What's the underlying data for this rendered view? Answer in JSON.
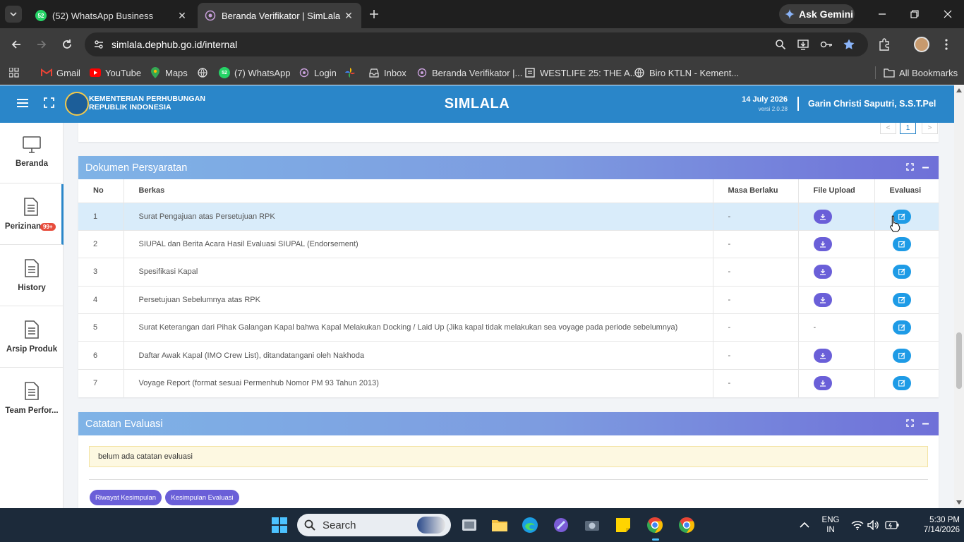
{
  "browser": {
    "tabs": [
      {
        "title": "(52) WhatsApp Business",
        "favicon": "whatsapp-icon",
        "active": false,
        "badge": "52"
      },
      {
        "title": "Beranda Verifikator | SimLala",
        "favicon": "simlala-icon",
        "active": true
      }
    ],
    "ask_gemini": "Ask Gemini",
    "url": "simlala.dephub.go.id/internal",
    "bookmarks": [
      {
        "label": "Gmail",
        "icon": "gmail-icon"
      },
      {
        "label": "YouTube",
        "icon": "youtube-icon"
      },
      {
        "label": "Maps",
        "icon": "maps-icon"
      },
      {
        "label": "",
        "icon": "globe-icon"
      },
      {
        "label": "(7) WhatsApp",
        "icon": "whatsapp-icon"
      },
      {
        "label": "Login",
        "icon": "simlala-icon"
      },
      {
        "label": "",
        "icon": "pinwheel-icon"
      },
      {
        "label": "Inbox",
        "icon": "inbox-icon"
      },
      {
        "label": "Beranda Verifikator |...",
        "icon": "simlala-icon"
      },
      {
        "label": "WESTLIFE 25: THE A...",
        "icon": "page-icon"
      },
      {
        "label": "Biro KTLN - Kement...",
        "icon": "globe-icon"
      }
    ],
    "all_bookmarks": "All Bookmarks"
  },
  "app": {
    "org_line1": "KEMENTERIAN PERHUBUNGAN",
    "org_line2": "REPUBLIK INDONESIA",
    "title": "SIMLALA",
    "date": "14 July 2026",
    "version": "versi 2.0.28",
    "user": "Garin Christi Saputri, S.S.T.Pel"
  },
  "sidebar": {
    "items": [
      {
        "label": "Beranda",
        "icon": "monitor-icon"
      },
      {
        "label": "Perizinan",
        "icon": "document-icon",
        "badge": "99+",
        "active": true
      },
      {
        "label": "History",
        "icon": "document-icon"
      },
      {
        "label": "Arsip Produk",
        "icon": "document-icon"
      },
      {
        "label": "Team Perfor...",
        "icon": "document-icon"
      }
    ]
  },
  "pagination": {
    "prev": "<",
    "current": "1",
    "next": ">"
  },
  "documents": {
    "title": "Dokumen Persyaratan",
    "columns": [
      "No",
      "Berkas",
      "Masa Berlaku",
      "File Upload",
      "Evaluasi"
    ],
    "rows": [
      {
        "no": "1",
        "berkas": "Surat Pengajuan atas Persetujuan RPK",
        "masa": "-",
        "file": "download",
        "highlighted": true
      },
      {
        "no": "2",
        "berkas": "SIUPAL dan Berita Acara Hasil Evaluasi SIUPAL (Endorsement)",
        "masa": "-",
        "file": "download"
      },
      {
        "no": "3",
        "berkas": "Spesifikasi Kapal",
        "masa": "-",
        "file": "download"
      },
      {
        "no": "4",
        "berkas": "Persetujuan Sebelumnya atas RPK",
        "masa": "-",
        "file": "download"
      },
      {
        "no": "5",
        "berkas": "Surat Keterangan dari Pihak Galangan Kapal bahwa Kapal Melakukan Docking / Laid Up (Jika kapal tidak melakukan sea voyage pada periode sebelumnya)",
        "masa": "-",
        "file": "-"
      },
      {
        "no": "6",
        "berkas": "Daftar Awak Kapal (IMO Crew List), ditandatangani oleh Nakhoda",
        "masa": "-",
        "file": "download"
      },
      {
        "no": "7",
        "berkas": "Voyage Report (format sesuai Permenhub Nomor PM 93 Tahun 2013)",
        "masa": "-",
        "file": "download"
      }
    ]
  },
  "evaluation": {
    "title": "Catatan Evaluasi",
    "note": "belum ada catatan evaluasi",
    "btn_history": "Riwayat Kesimpulan",
    "btn_conclusion": "Kesimpulan Evaluasi"
  },
  "taskbar": {
    "search": "Search",
    "lang1": "ENG",
    "lang2": "IN",
    "time": "5:30 PM",
    "date": "7/14/2026"
  },
  "colors": {
    "header_blue": "#2a86c9",
    "card_gradient_start": "#7fb3e6",
    "card_gradient_end": "#6f70d8",
    "download_button": "#6a5fd8",
    "evaluate_button": "#1e9be6",
    "highlight_row": "#d9ecfa"
  }
}
